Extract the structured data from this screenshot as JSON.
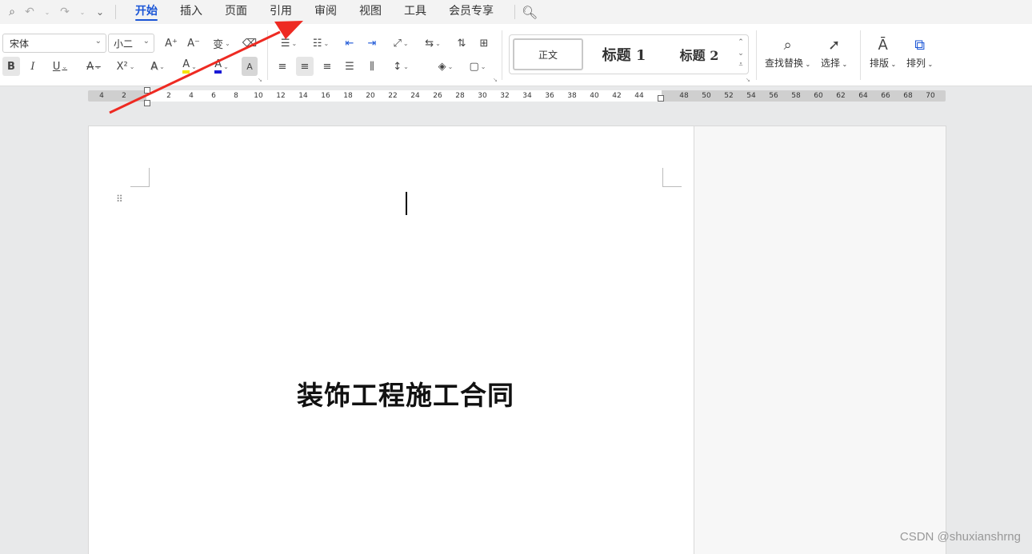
{
  "quick_access": {
    "icons": [
      "file-preview-icon",
      "undo-icon",
      "redo-icon",
      "more-icon"
    ]
  },
  "tabs": [
    {
      "label": "开始",
      "active": true
    },
    {
      "label": "插入",
      "active": false
    },
    {
      "label": "页面",
      "active": false
    },
    {
      "label": "引用",
      "active": false
    },
    {
      "label": "审阅",
      "active": false
    },
    {
      "label": "视图",
      "active": false
    },
    {
      "label": "工具",
      "active": false
    },
    {
      "label": "会员专享",
      "active": false
    }
  ],
  "ribbon": {
    "font_name": "宋体",
    "font_size": "小二",
    "bold": "B",
    "italic": "I",
    "underline": "U",
    "strike": "A",
    "superscript": "X²",
    "font_grow": "A⁺",
    "font_shrink": "A⁻",
    "phonetic": "变",
    "text_effect": "A",
    "highlight": "A",
    "font_color": "A",
    "char_shade": "A",
    "styles": {
      "normal": "正文",
      "heading1": "标题 1",
      "heading2": "标题 2"
    },
    "find_replace": "查找替换",
    "select": "选择",
    "layout": "排版",
    "arrange": "排列"
  },
  "ruler": {
    "ticks": [
      "4",
      "2",
      "2",
      "4",
      "6",
      "8",
      "10",
      "12",
      "14",
      "16",
      "18",
      "20",
      "22",
      "24",
      "26",
      "28",
      "30",
      "32",
      "34",
      "36",
      "38",
      "40",
      "42",
      "44",
      "48",
      "50",
      "52",
      "54",
      "56",
      "58",
      "60",
      "62",
      "64",
      "66",
      "68",
      "70"
    ]
  },
  "document": {
    "title": "装饰工程施工合同"
  },
  "watermark": "CSDN @shuxianshrng",
  "colors": {
    "accent": "#1a55d6",
    "arrow": "#ee2a22",
    "highlight_bar": "#f5e400",
    "font_color_bar": "#1a1ad6"
  }
}
